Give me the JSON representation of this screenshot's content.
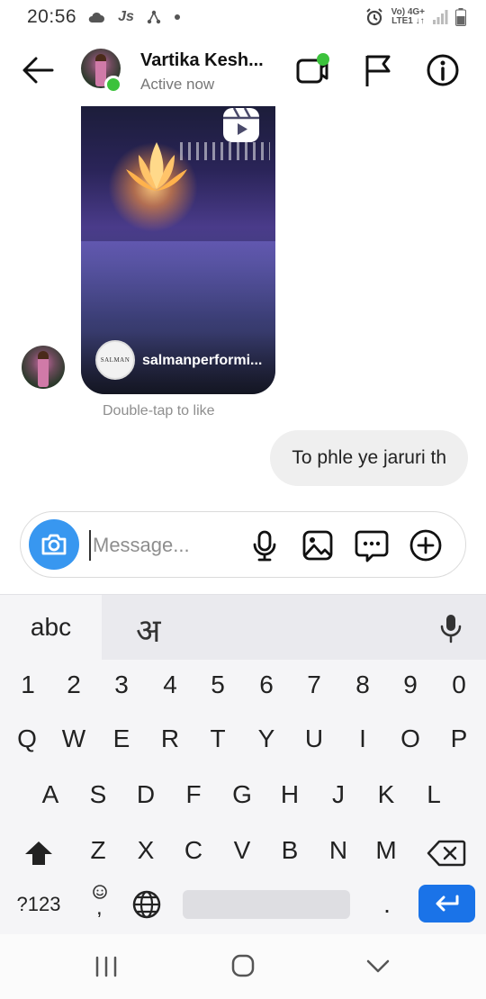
{
  "status_bar": {
    "time": "20:56",
    "app_icons": [
      "cloud-icon",
      "js-icon",
      "share-icon",
      "dot-icon"
    ],
    "alarm_icon": "alarm-icon",
    "network_label_top": "Vo) 4G+",
    "network_label_bottom": "LTE1 ↓↑"
  },
  "header": {
    "contact_name": "Vartika Kesh...",
    "contact_status": "Active now",
    "back_icon": "back-arrow-icon",
    "video_icon": "video-call-icon",
    "flag_icon": "flag-icon",
    "info_icon": "info-icon",
    "online_color": "#3cc23c"
  },
  "chat": {
    "reel": {
      "username": "salmanperformi...",
      "account_logo_text": "SALMAN",
      "play_icon": "reels-icon"
    },
    "double_tap_hint": "Double-tap to like",
    "outgoing_message": "To phle ye jaruri th"
  },
  "composer": {
    "placeholder": "Message...",
    "camera_icon": "camera-icon",
    "mic_icon": "microphone-icon",
    "gallery_icon": "gallery-icon",
    "sticker_icon": "chat-sticker-icon",
    "add_icon": "plus-circle-icon",
    "accent_color": "#3897f0"
  },
  "keyboard": {
    "tab_abc": "abc",
    "tab_hindi": "अ",
    "number_row": [
      "1",
      "2",
      "3",
      "4",
      "5",
      "6",
      "7",
      "8",
      "9",
      "0"
    ],
    "row1": [
      "Q",
      "W",
      "E",
      "R",
      "T",
      "Y",
      "U",
      "I",
      "O",
      "P"
    ],
    "row2": [
      "A",
      "S",
      "D",
      "F",
      "G",
      "H",
      "J",
      "K",
      "L"
    ],
    "row3": [
      "Z",
      "X",
      "C",
      "V",
      "B",
      "N",
      "M"
    ],
    "symbols_key": "?123",
    "emoji_comma_key": ",",
    "period_key": ".",
    "enter_color": "#1a73e8"
  },
  "nav_bar": {
    "recents_icon": "recents-icon",
    "home_icon": "home-icon",
    "back_icon": "nav-back-icon"
  }
}
